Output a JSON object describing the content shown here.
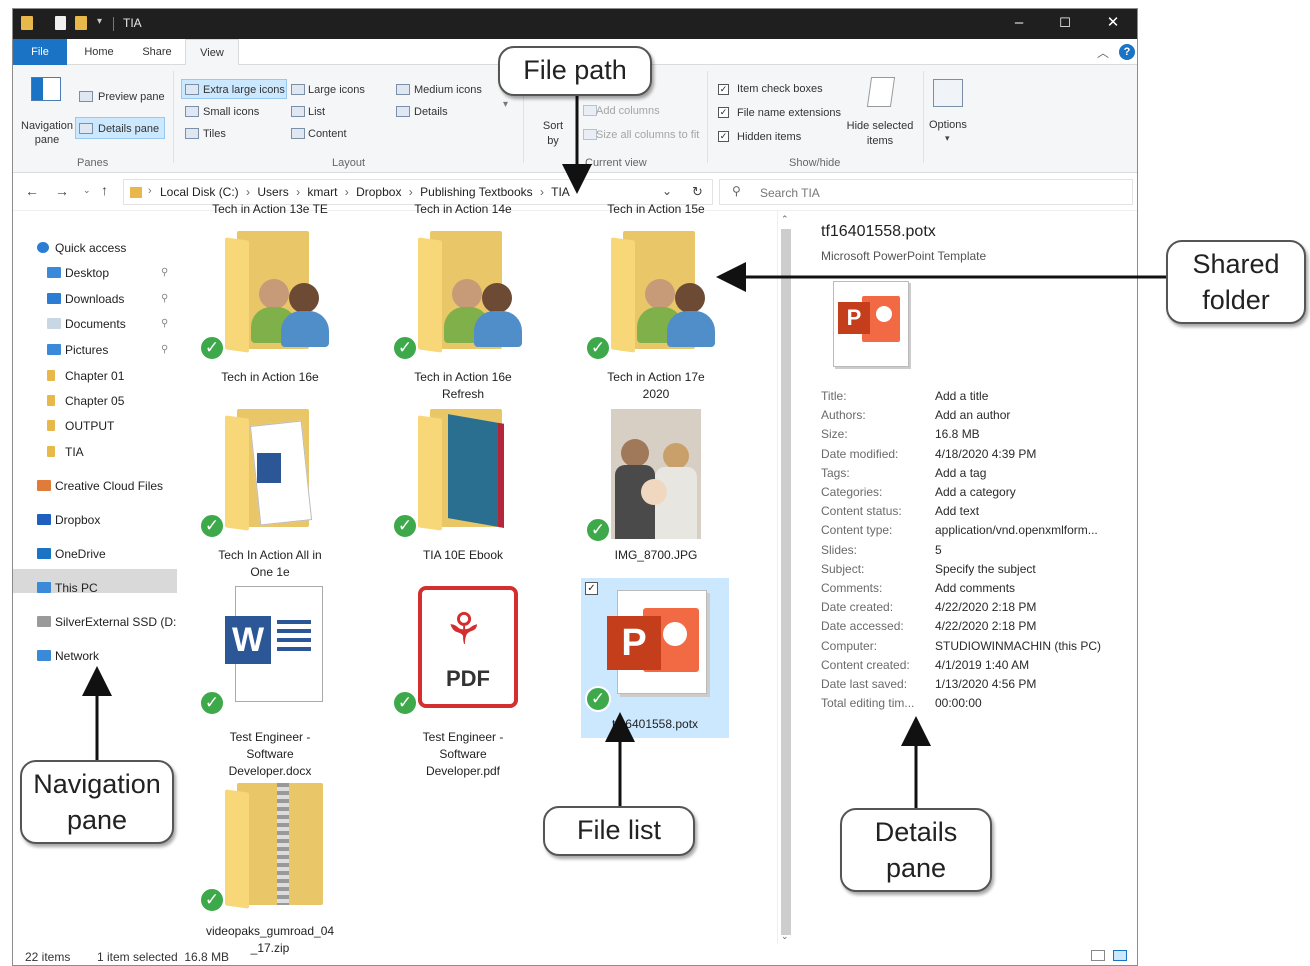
{
  "window": {
    "title": "TIA",
    "controls": {
      "minimize": "–",
      "maximize": "☐",
      "close": "✕"
    }
  },
  "menu_tabs": [
    "File",
    "Home",
    "Share",
    "View"
  ],
  "ribbon": {
    "panes": {
      "navigation_pane": "Navigation pane",
      "preview_pane": "Preview pane",
      "details_pane": "Details pane",
      "group_label": "Panes"
    },
    "layout": {
      "options": [
        "Extra large icons",
        "Large icons",
        "Medium icons",
        "Small icons",
        "List",
        "Details",
        "Tiles",
        "Content"
      ],
      "group_label": "Layout"
    },
    "current_view": {
      "sort_by": "Sort by",
      "add_columns": "Add columns",
      "size_all_columns": "Size all columns to fit",
      "group_label": "Current view"
    },
    "show_hide": {
      "item_check_boxes": "Item check boxes",
      "file_name_extensions": "File name extensions",
      "hidden_items": "Hidden items",
      "hide_selected_items": "Hide selected items",
      "group_label": "Show/hide"
    },
    "options": "Options"
  },
  "address_bar": {
    "path": [
      "Local Disk (C:)",
      "Users",
      "kmart",
      "Dropbox",
      "Publishing Textbooks",
      "TIA"
    ],
    "search_placeholder": "Search TIA"
  },
  "navigation": {
    "items": [
      {
        "label": "Quick access",
        "icon": "star-icon"
      },
      {
        "label": "Desktop",
        "icon": "desktop-icon",
        "pinned": true
      },
      {
        "label": "Downloads",
        "icon": "download-icon",
        "pinned": true
      },
      {
        "label": "Documents",
        "icon": "documents-icon",
        "pinned": true
      },
      {
        "label": "Pictures",
        "icon": "pictures-icon",
        "pinned": true
      },
      {
        "label": "Chapter 01",
        "icon": "folder-icon"
      },
      {
        "label": "Chapter 05",
        "icon": "folder-icon"
      },
      {
        "label": "OUTPUT",
        "icon": "folder-icon"
      },
      {
        "label": "TIA",
        "icon": "folder-icon"
      },
      {
        "label": "Creative Cloud Files",
        "icon": "creative-cloud-icon"
      },
      {
        "label": "Dropbox",
        "icon": "dropbox-icon"
      },
      {
        "label": "OneDrive",
        "icon": "onedrive-icon"
      },
      {
        "label": "This PC",
        "icon": "computer-icon",
        "selected": true
      },
      {
        "label": "SilverExternal SSD (D:",
        "icon": "drive-icon"
      },
      {
        "label": "Network",
        "icon": "network-icon"
      }
    ]
  },
  "file_list": {
    "top_captions": [
      "Tech in Action 13e TE",
      "Tech in Action 14e",
      "Tech in Action 15e"
    ],
    "items": [
      {
        "name_lines": [
          "Tech in Action 16e"
        ],
        "type": "shared-folder"
      },
      {
        "name_lines": [
          "Tech in Action 16e",
          "Refresh"
        ],
        "type": "shared-folder"
      },
      {
        "name_lines": [
          "Tech in Action 17e",
          "2020"
        ],
        "type": "shared-folder"
      },
      {
        "name_lines": [
          "Tech In Action All in",
          "One 1e"
        ],
        "type": "folder-document"
      },
      {
        "name_lines": [
          "TIA 10E Ebook"
        ],
        "type": "folder-book"
      },
      {
        "name_lines": [
          "IMG_8700.JPG"
        ],
        "type": "photo"
      },
      {
        "name_lines": [
          "Test Engineer -",
          "Software",
          "Developer.docx"
        ],
        "type": "word",
        "badge": "W"
      },
      {
        "name_lines": [
          "Test Engineer -",
          "Software",
          "Developer.pdf"
        ],
        "type": "pdf",
        "badge": "PDF"
      },
      {
        "name_lines": [
          "tf16401558.potx"
        ],
        "type": "powerpoint",
        "badge": "P",
        "selected": true
      },
      {
        "name_lines": [
          "videopaks_gumroad_04",
          "_17.zip"
        ],
        "type": "zip"
      }
    ]
  },
  "details_pane": {
    "filename": "tf16401558.potx",
    "filetype": "Microsoft PowerPoint Template",
    "badge": "P",
    "properties": [
      {
        "label": "Title:",
        "value": "Add a title"
      },
      {
        "label": "Authors:",
        "value": "Add an author"
      },
      {
        "label": "Size:",
        "value": "16.8 MB"
      },
      {
        "label": "Date modified:",
        "value": "4/18/2020 4:39 PM"
      },
      {
        "label": "Tags:",
        "value": "Add a tag"
      },
      {
        "label": "Categories:",
        "value": "Add a category"
      },
      {
        "label": "Content status:",
        "value": "Add text"
      },
      {
        "label": "Content type:",
        "value": "application/vnd.openxmlform..."
      },
      {
        "label": "Slides:",
        "value": "5"
      },
      {
        "label": "Subject:",
        "value": "Specify the subject"
      },
      {
        "label": "Comments:",
        "value": "Add comments"
      },
      {
        "label": "Date created:",
        "value": "4/22/2020 2:18 PM"
      },
      {
        "label": "Date accessed:",
        "value": "4/22/2020 2:18 PM"
      },
      {
        "label": "Computer:",
        "value": "STUDIOWINMACHIN (this PC)"
      },
      {
        "label": "Content created:",
        "value": "4/1/2019 1:40 AM"
      },
      {
        "label": "Date last saved:",
        "value": "1/13/2020 4:56 PM"
      },
      {
        "label": "Total editing tim...",
        "value": "00:00:00"
      }
    ]
  },
  "status_bar": {
    "item_count": "22 items",
    "selection": "1 item selected  16.8 MB"
  },
  "callouts": {
    "file_path": "File path",
    "shared_folder": [
      "Shared",
      "folder"
    ],
    "navigation_pane": [
      "Navigation",
      "pane"
    ],
    "file_list": "File list",
    "details_pane": [
      "Details",
      "pane"
    ]
  },
  "colors": {
    "titlebar": "#1f1f1f",
    "accent_blue": "#1a73c4",
    "selection": "#cce8ff",
    "folder": "#f8d778",
    "check_green": "#3da94b",
    "powerpoint": "#c43e1c",
    "word": "#2b5797",
    "pdf": "#d32f2f"
  }
}
